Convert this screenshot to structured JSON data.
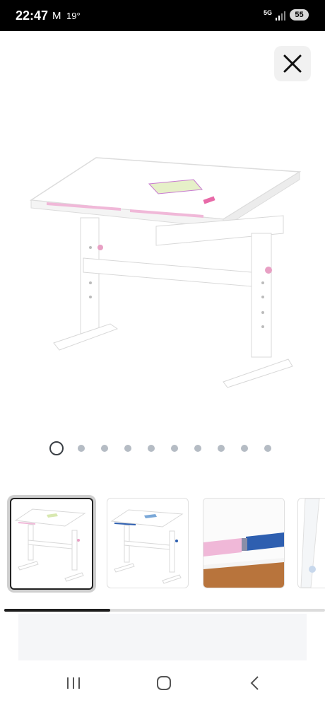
{
  "status_bar": {
    "time": "22:47",
    "mail_glyph": "M",
    "temperature": "19°",
    "network": "5G",
    "battery": "55"
  },
  "carousel": {
    "image_count": 10,
    "active_index": 0
  },
  "thumbnails": [
    "desk-pink",
    "desk-blue",
    "detail-joint",
    "detail-edge"
  ],
  "scroll_progress": 0.33,
  "icons": {
    "close": "close-icon",
    "nav_recent": "recent-apps-icon",
    "nav_home": "home-icon",
    "nav_back": "back-icon"
  },
  "colors": {
    "accent_pink": "#f0b8d8",
    "accent_blue": "#2e5fb0",
    "dot_inactive": "#b5bcc4",
    "dot_active": "#3a3f45"
  }
}
